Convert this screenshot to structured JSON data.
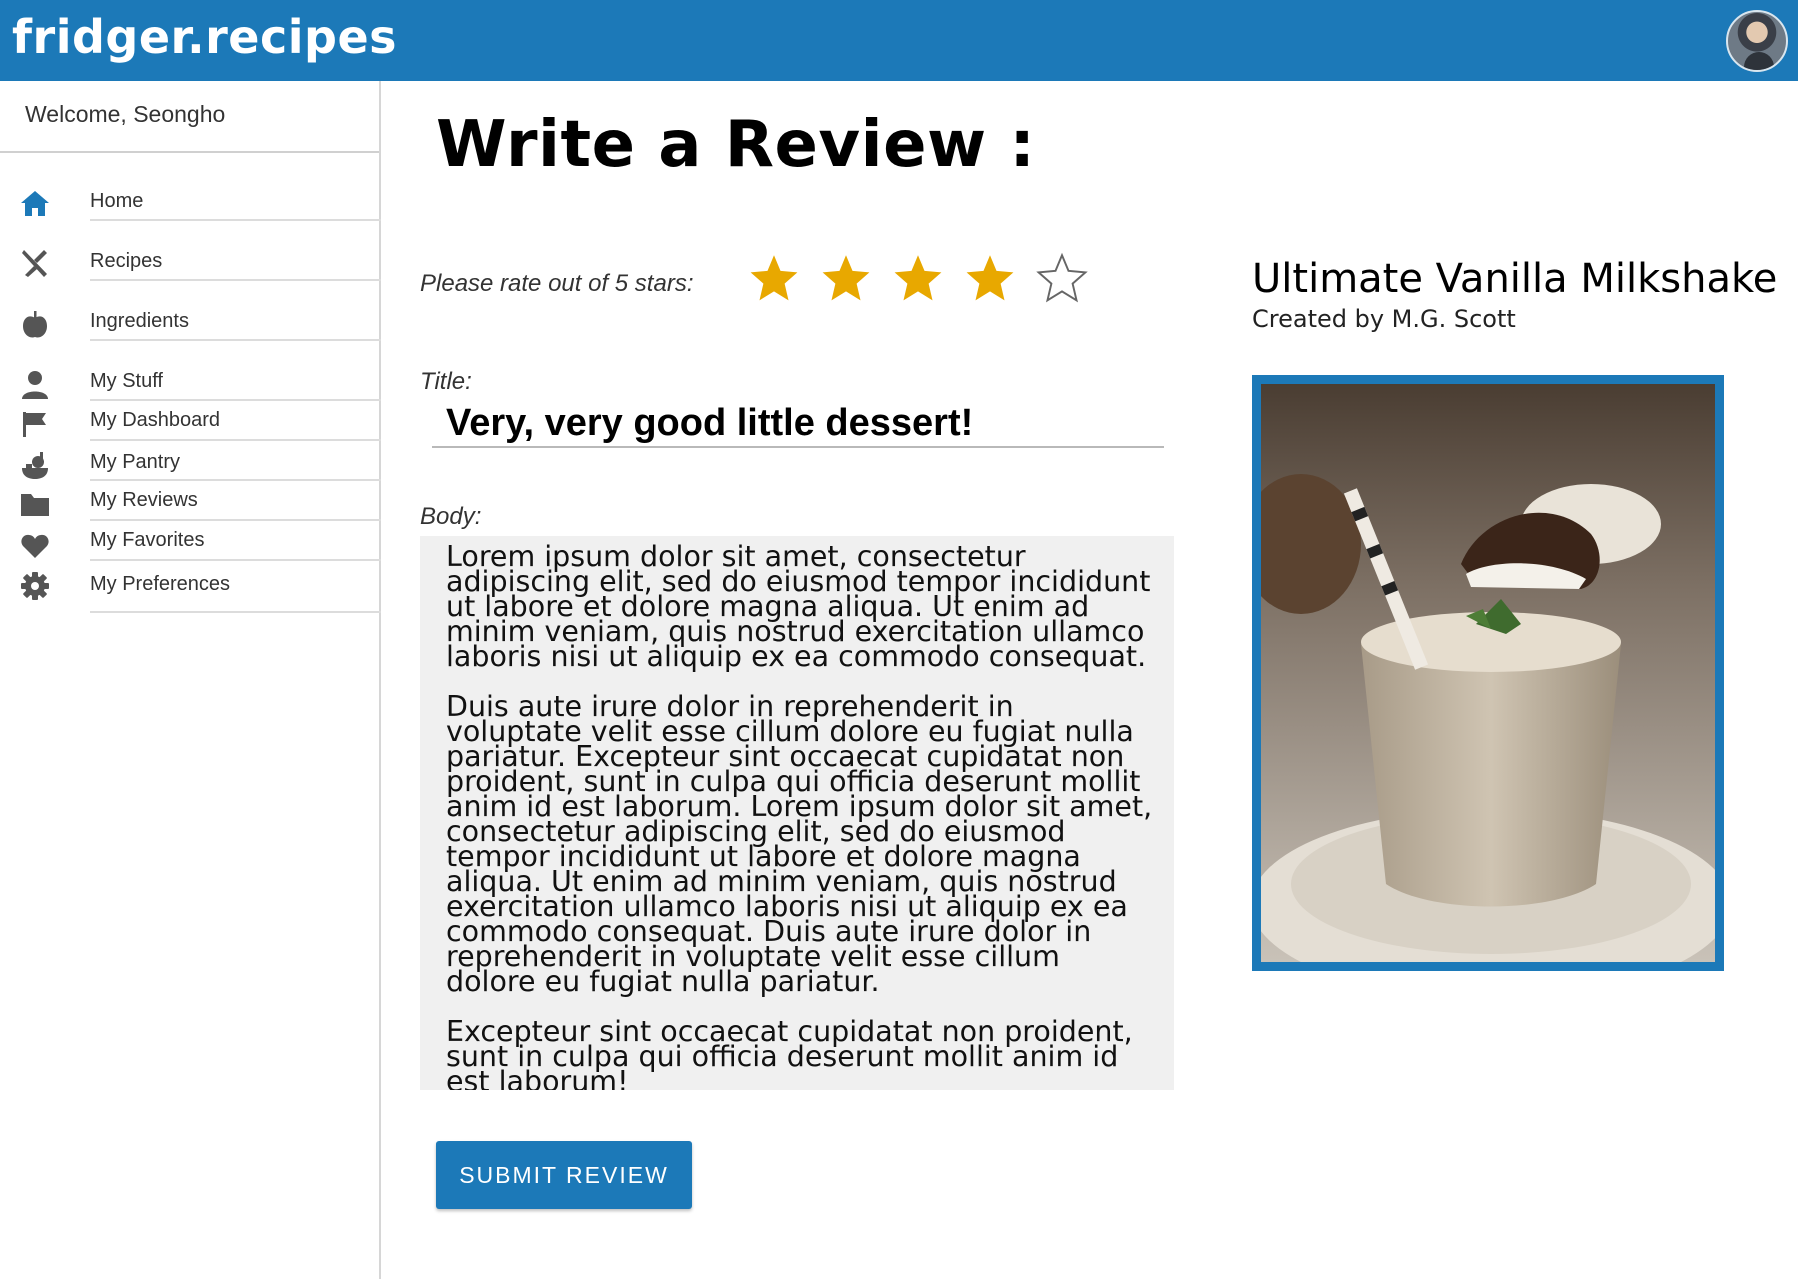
{
  "header": {
    "brand": "fridger.recipes",
    "avatar_icon": "user-avatar"
  },
  "sidebar": {
    "welcome": "Welcome, Seongho",
    "items": [
      {
        "label": "Home",
        "icon": "home-icon",
        "color": "#1c79b8"
      },
      {
        "label": "Recipes",
        "icon": "utensils-icon",
        "color": "#555555"
      },
      {
        "label": "Ingredients",
        "icon": "apple-icon",
        "color": "#555555"
      },
      {
        "label": "My Stuff",
        "icon": "user-icon",
        "color": "#555555"
      },
      {
        "label": "My Dashboard",
        "icon": "flag-icon",
        "color": "#555555"
      },
      {
        "label": "My Pantry",
        "icon": "pantry-icon",
        "color": "#555555"
      },
      {
        "label": "My Reviews",
        "icon": "folder-icon",
        "color": "#555555"
      },
      {
        "label": "My Favorites",
        "icon": "heart-icon",
        "color": "#555555"
      },
      {
        "label": "My Preferences",
        "icon": "gear-icon",
        "color": "#555555"
      }
    ]
  },
  "review": {
    "page_title": "Write a Review :",
    "rating_label": "Please rate out of 5 stars:",
    "rating": 4,
    "rating_max": 5,
    "star_color": "#e8a800",
    "title_label": "Title:",
    "title_value": "Very, very good little dessert!",
    "body_label": "Body:",
    "body_paragraphs": [
      "Lorem ipsum dolor sit amet, consectetur adipiscing elit, sed do eiusmod tempor incididunt ut labore et dolore magna aliqua. Ut enim ad minim veniam, quis nostrud exercitation ullamco laboris nisi ut aliquip ex ea commodo consequat.",
      "Duis aute irure dolor in reprehenderit in voluptate velit esse cillum dolore eu fugiat nulla pariatur. Excepteur sint occaecat cupidatat non proident, sunt in culpa qui officia deserunt mollit anim id est laborum.  Lorem ipsum dolor sit amet, consectetur adipiscing elit, sed do eiusmod tempor incididunt ut labore et dolore magna aliqua. Ut enim ad minim veniam, quis nostrud exercitation ullamco laboris nisi ut aliquip ex ea commodo consequat. Duis aute irure dolor in reprehenderit in voluptate velit esse cillum dolore eu fugiat nulla pariatur.",
      "Excepteur sint occaecat cupidatat non proident, sunt in culpa qui officia deserunt mollit anim id est laborum!"
    ],
    "submit_label": "SUBMIT REVIEW"
  },
  "recipe": {
    "name": "Ultimate Vanilla Milkshake",
    "author": "Created by M.G. Scott",
    "image_icon": "milkshake-photo",
    "accent_color": "#1c79b8"
  }
}
